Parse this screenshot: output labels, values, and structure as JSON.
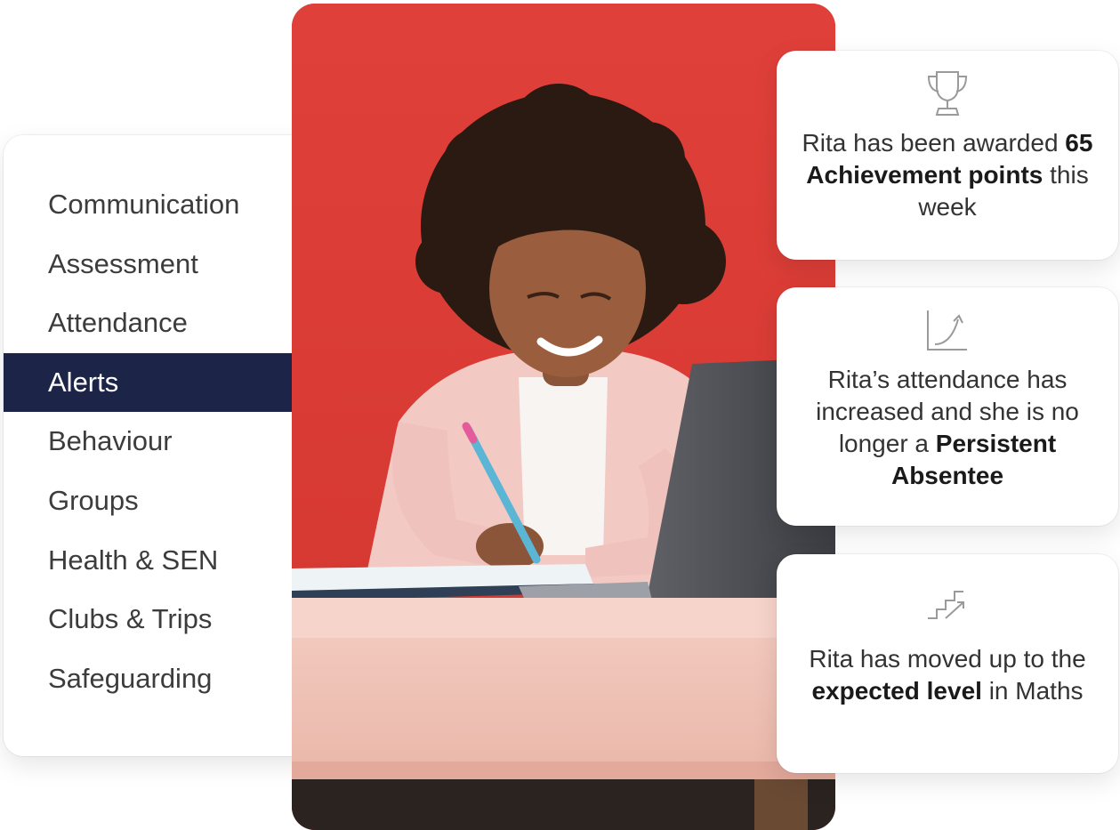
{
  "menu": {
    "items": [
      {
        "label": "Communication"
      },
      {
        "label": "Assessment"
      },
      {
        "label": "Attendance"
      },
      {
        "label": "Alerts",
        "active": true
      },
      {
        "label": "Behaviour"
      },
      {
        "label": "Groups"
      },
      {
        "label": "Health & SEN"
      },
      {
        "label": "Clubs & Trips"
      },
      {
        "label": "Safeguarding"
      }
    ]
  },
  "cards": {
    "achievement": {
      "icon": "trophy-icon",
      "text_before": "Rita has been awarded ",
      "bold": "65 Achievement points",
      "text_after": " this week"
    },
    "attendance": {
      "icon": "growth-chart-icon",
      "text_before": "Rita’s attendance has increased and she is no longer a ",
      "bold": "Persistent Absentee",
      "text_after": ""
    },
    "assessment": {
      "icon": "stairs-up-icon",
      "text_before": "Rita has moved up to the ",
      "bold": "expected level",
      "text_after": " in Maths"
    }
  },
  "colors": {
    "accent_navy": "#1c2447",
    "photo_background": "#dc3b33"
  }
}
